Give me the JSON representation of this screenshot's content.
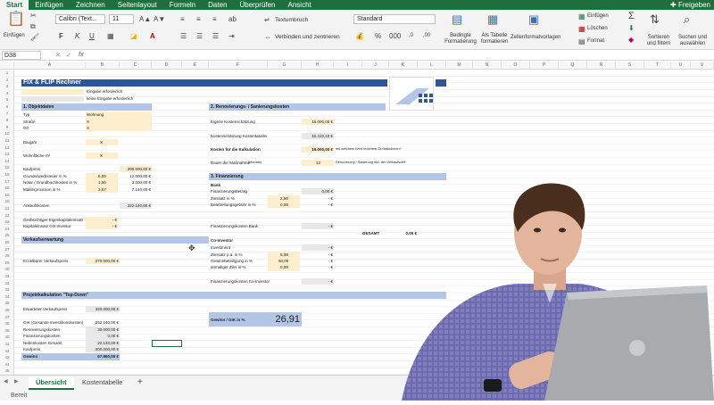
{
  "ribbon_tabs": [
    "Start",
    "Einfügen",
    "Zeichnen",
    "Seitenlayout",
    "Formeln",
    "Daten",
    "Überprüfen",
    "Ansicht"
  ],
  "share_label": "Freigeben",
  "ribbon": {
    "paste": "Einfügen",
    "font_name": "Calibri (Text...",
    "font_size": "11",
    "bold": "F",
    "italic": "K",
    "underline": "U",
    "wrap": "Textumbruch",
    "merge": "Verbinden und zentrieren",
    "number_format": "Standard",
    "cond_format": "Bedingte Formatierung",
    "as_table": "Als Tabelle formatieren",
    "cell_styles": "Zellenformatvorlagen",
    "insert": "Einfügen",
    "delete": "Löschen",
    "format": "Format",
    "sort": "Sortieren und filtern",
    "find": "Suchen und auswählen"
  },
  "name_box": "D38",
  "fx": "fx",
  "columns": [
    "A",
    "B",
    "C",
    "D",
    "E",
    "F",
    "G",
    "H",
    "I",
    "J",
    "K",
    "L",
    "M",
    "N",
    "O",
    "P",
    "Q",
    "R",
    "S",
    "T",
    "U",
    "V"
  ],
  "sheet": {
    "title": "FIX & FLIP Rechner",
    "legend1": "Eingabe erforderlich",
    "legend2": "keine Eingabe erforderlich",
    "s1": "1. Objektdaten",
    "typ": "Typ",
    "typ_v": "Wohnung",
    "strasse": "Straße",
    "strasse_v": "X",
    "ort": "Ort",
    "ort_v": "X",
    "baujahr": "Baujahr",
    "baujahr_v": "X",
    "wohnflaeche": "Wohnfläche m²",
    "wohnflaeche_v": "X",
    "kaufpreis": "Kaufpreis",
    "kaufpreis_v": "200.000,00 €",
    "grunderwerb": "Grunderwerbsteuer in %",
    "grunderwerb_p": "6,00",
    "grunderwerb_v": "12.000,00 €",
    "notar": "Notar / Grundbuchkosten in %",
    "notar_p": "1,50",
    "notar_v": "3.000,00 €",
    "makler": "Maklerprovision in %",
    "makler_p": "3,57",
    "makler_v": "7.140,00 €",
    "ankauf": "Ankaufskosten",
    "ankauf_v": "222.140,00 €",
    "eigenkapital": "Gesbsichtiger Eigenkapitaleinsatz",
    "eigenkapital_v": "- €",
    "co_investor": "Kapitaleinsatz CO-Investor",
    "co_investor_v": "- €",
    "s2": "2. Renovierungs- / Sanierungskosten",
    "eigene_kosten": "Eigene Kostenschätzung",
    "eigene_kosten_v": "15.000,00 €",
    "kosten_tabelle": "Kostenschätzung Kostentabelle",
    "kosten_tabelle_v": "15.410,10 €",
    "basis": "Kosten für die Kalkulation",
    "basis_v": "16.000,00 €",
    "basis_note": "mit welchem Wert möchtest Du kalkulieren?",
    "dauer": "Dauer der Maßnahme",
    "dauer_unit": "(Monate)",
    "dauer_v": "12",
    "dauer_note": "Renovierung / Sanierung inkl. der Verkaufszeit",
    "s3": "3. Finanzierung",
    "bank": "Bank",
    "fin_betrag": "Finanzierungsbetrag",
    "fin_betrag_v": "0,00 €",
    "zinssatz": "Zinssatz in %",
    "zinssatz_p": "2,50",
    "zinssatz_v": "- €",
    "bearbeitung": "Bearbeitungsgebühr in %",
    "bearbeitung_p": "0,00",
    "bearbeitung_v": "- €",
    "fin_bank": "Finanzierungskosten Bank",
    "fin_bank_v": "- €",
    "gesamt": "GESAMT",
    "gesamt_v": "0,00 €",
    "coinv": "Co-Investor",
    "investment": "Investment",
    "investment_v": "- €",
    "zins_pa": "Zinssatz p.a. in %",
    "zins_pa_p": "5,00",
    "zins_pa_v": "- €",
    "gewinnbet": "Gewinnbeteiligung in %",
    "gewinnbet_p": "50,00",
    "gewinnbet_v": "- €",
    "mindest": "anmaliger Zins in %",
    "mindest_p": "0,00",
    "mindest_v": "- €",
    "fin_co": "Finanzierungskosten Co-Investor",
    "fin_co_v": "- €",
    "s4": "Verkaufserwartung",
    "vk_preis": "Erzielbarer Verkaufspreis",
    "vk_preis_v": "270.000,00 €",
    "s5": "Projektkalkulation \"Top-Down\"",
    "erwartet": "Erwarteter Verkaufspreis",
    "erwartet_v": "320.000,00 €",
    "gik": "GIK (Gesamte Investitionskosten)",
    "gik_v": "252.140,00 €",
    "reno": "Renovierungskosten",
    "reno_v": "30.000,00 €",
    "finkost": "Finanzierungskosten",
    "finkost_v": "0,00 €",
    "neben": "Nebenkosten Gesamt",
    "neben_v": "22.140,00 €",
    "kp": "Kaufpreis",
    "kp_v": "200.000,00 €",
    "gewinn": "Gewinn",
    "gewinn_v": "67.860,00 €",
    "roi": "Gewinn / GIK in %",
    "roi_v": "26,91"
  },
  "sheet_tabs": [
    "Übersicht",
    "Kostentabelle"
  ],
  "status": "Bereit",
  "colors": {
    "excel_green": "#1e6e3e",
    "header_blue": "#2f5597",
    "section_blue": "#b4c6e7",
    "input": "#fdeecd",
    "readonly": "#e8e8e8"
  }
}
